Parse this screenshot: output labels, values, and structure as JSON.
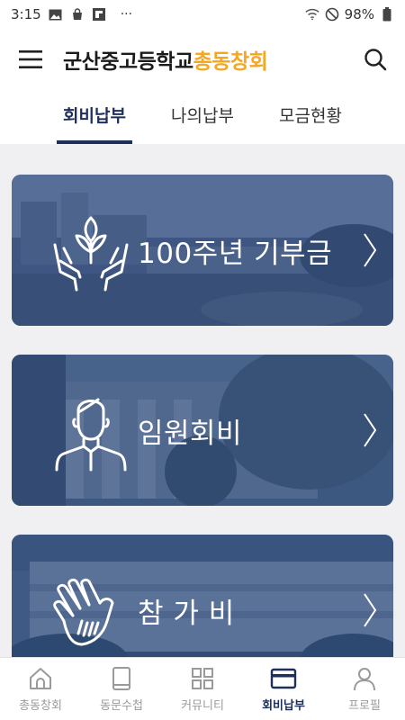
{
  "status_bar": {
    "time": "3:15",
    "battery": "98%",
    "more": "···"
  },
  "header": {
    "menu_icon": "hamburger-menu-icon",
    "title_main": "군산중고등학교",
    "title_accent": "총동창회",
    "search_icon": "search-icon"
  },
  "tabs": [
    {
      "label": "회비납부",
      "active": true
    },
    {
      "label": "나의납부",
      "active": false
    },
    {
      "label": "모금현황",
      "active": false
    }
  ],
  "cards": [
    {
      "label": "100주년 기부금",
      "icon": "hands-plant-icon"
    },
    {
      "label": "임원회비",
      "icon": "person-icon"
    },
    {
      "label": "참 가 비",
      "icon": "hand-raise-icon"
    }
  ],
  "bottom_nav": [
    {
      "label": "총동창회",
      "icon": "home-icon",
      "active": false
    },
    {
      "label": "동문수첩",
      "icon": "book-icon",
      "active": false
    },
    {
      "label": "커뮤니티",
      "icon": "grid-icon",
      "active": false
    },
    {
      "label": "회비납부",
      "icon": "card-icon",
      "active": true
    },
    {
      "label": "프로필",
      "icon": "profile-icon",
      "active": false
    }
  ],
  "colors": {
    "accent": "#f5a623",
    "primary": "#1e2f5a",
    "card_tint": "#2b4478"
  }
}
